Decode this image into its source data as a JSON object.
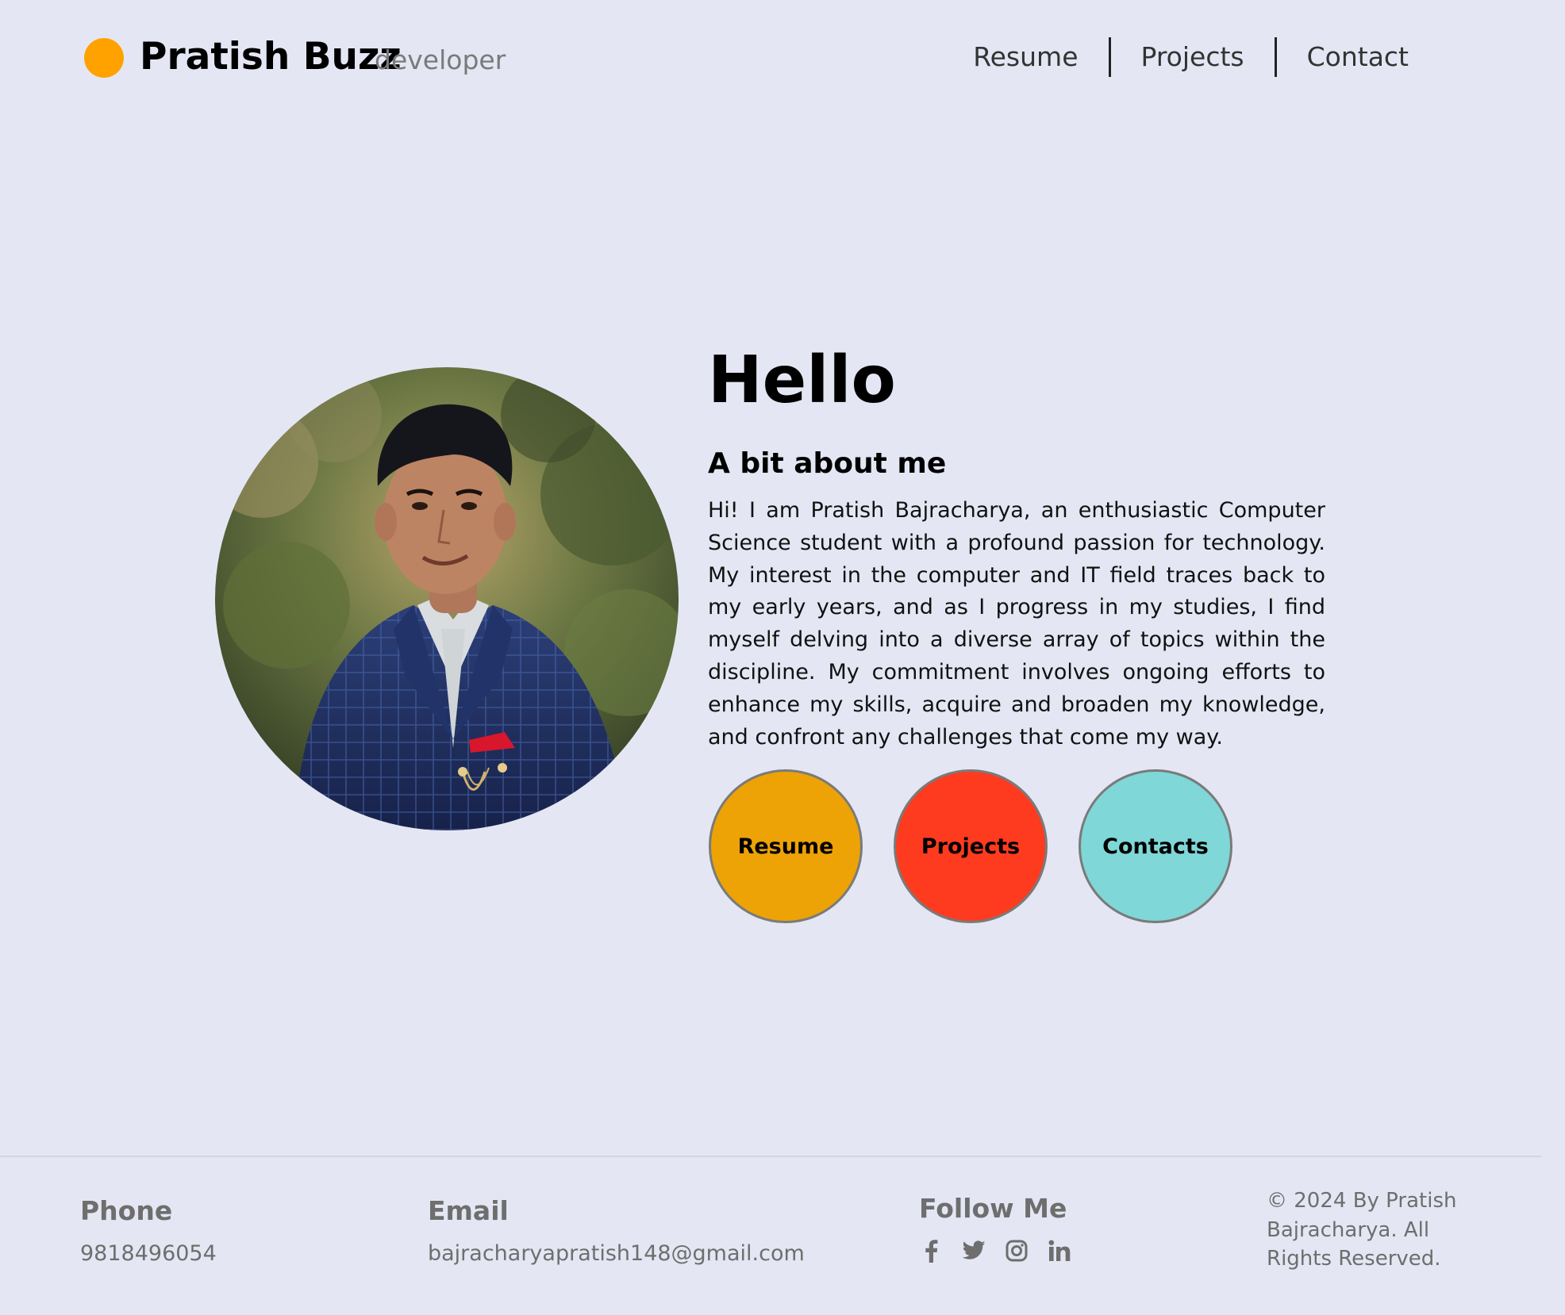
{
  "header": {
    "brand_name": "Pratish Buzz",
    "brand_subtitle": "developer",
    "logo_color": "#ffa200",
    "nav": [
      {
        "label": "Resume"
      },
      {
        "label": "Projects"
      },
      {
        "label": "Contact"
      }
    ]
  },
  "hero": {
    "greeting": "Hello",
    "about_heading": "A bit about me",
    "about_text": "Hi! I am Pratish Bajracharya, an enthusiastic Computer Science student with a profound passion for technology. My interest in the computer and IT field traces back to my early years, and as I progress in my studies, I find myself delving into a diverse array of topics within the discipline. My commitment involves ongoing efforts to enhance my skills, acquire and broaden my knowledge, and confront any challenges that come my way.",
    "photo_icon": "profile-photo",
    "buttons": [
      {
        "label": "Resume",
        "color": "#eda306"
      },
      {
        "label": "Projects",
        "color": "#ff3b1f"
      },
      {
        "label": "Contacts",
        "color": "#7fd7d7"
      }
    ]
  },
  "footer": {
    "phone_heading": "Phone",
    "phone_value": "9818496054",
    "email_heading": "Email",
    "email_value": "bajracharyapratish148@gmail.com",
    "follow_heading": "Follow Me",
    "social_icons": [
      "facebook-icon",
      "twitter-icon",
      "instagram-icon",
      "linkedin-icon"
    ],
    "copyright": "© 2024 By Pratish Bajracharya. All Rights Reserved."
  }
}
